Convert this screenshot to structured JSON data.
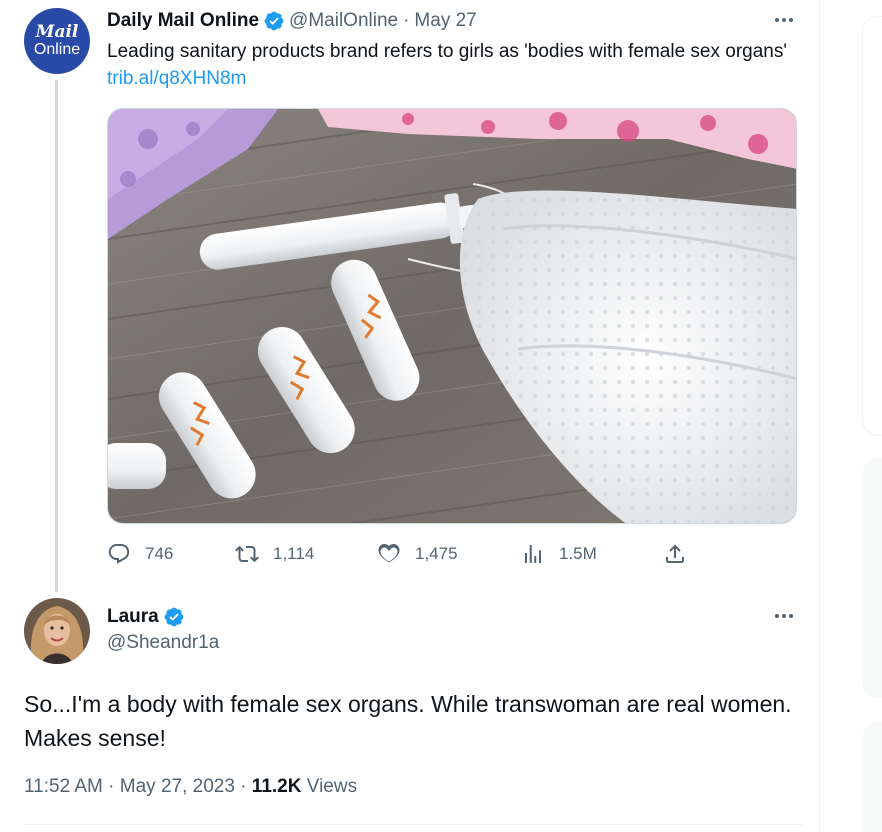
{
  "tweet": {
    "author_name": "Daily Mail Online",
    "avatar_text": [
      "Mail",
      "Online"
    ],
    "handle": "@MailOnline",
    "separator": "·",
    "date": "May 27",
    "text": "Leading sanitary products brand refers to girls as 'bodies with female sex organs'",
    "link": "trib.al/q8XHN8m",
    "stats": {
      "replies": "746",
      "retweets": "1,114",
      "likes": "1,475",
      "views": "1.5M"
    }
  },
  "reply": {
    "author_name": "Laura",
    "handle": "@Sheandr1a",
    "text": "So...I'm a body with female sex organs.  While transwoman are real women.  Makes sense!",
    "time": "11:52 AM",
    "separator": "·",
    "date": "May 27, 2023",
    "views_count": "11.2K",
    "views_label": "Views"
  },
  "colors": {
    "accent": "#1d9bf0",
    "muted_text": "#536471",
    "thread_line": "#cfd9de",
    "verified_badge": "#1d9bf0",
    "mail_online_blue": "#2a4aa8"
  },
  "icons": [
    "verified-badge-icon",
    "more-icon",
    "reply-icon",
    "retweet-icon",
    "like-icon",
    "views-icon",
    "share-icon"
  ]
}
